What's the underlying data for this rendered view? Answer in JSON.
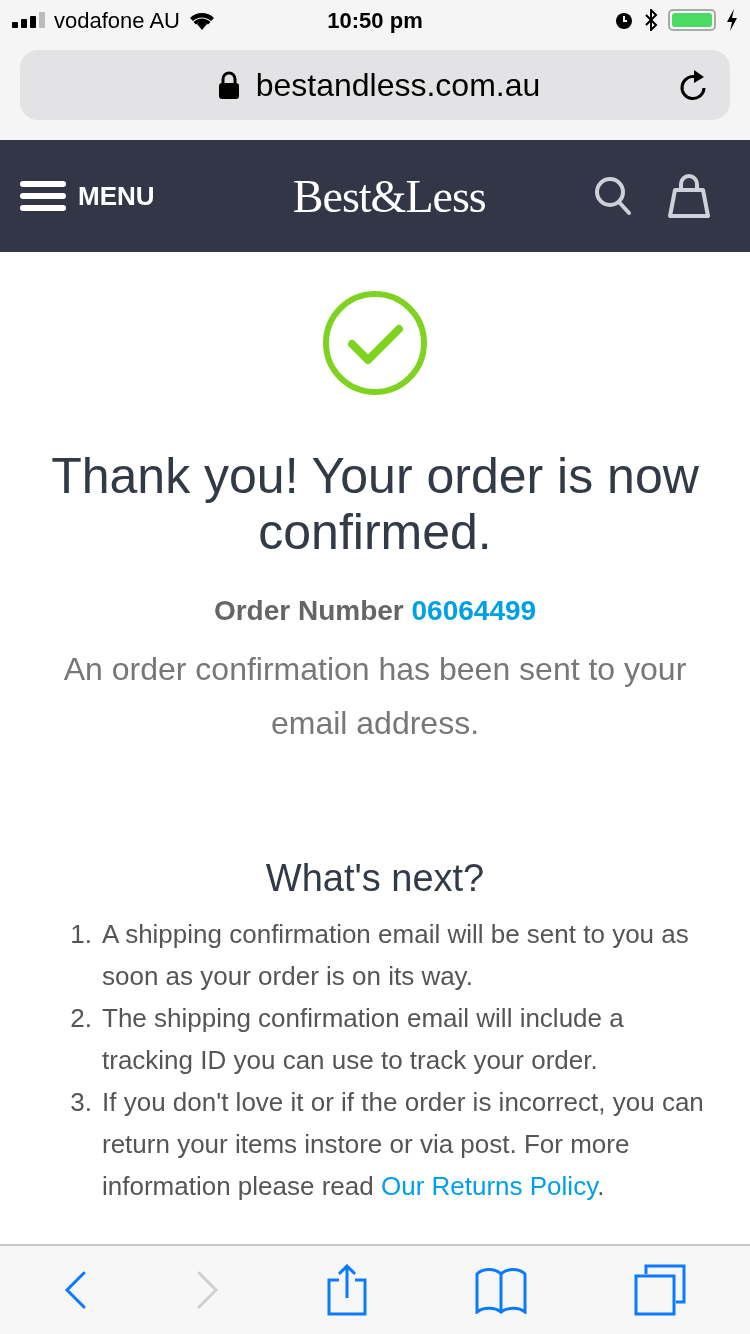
{
  "status_bar": {
    "carrier": "vodafone AU",
    "time": "10:50 pm"
  },
  "address_bar": {
    "url": "bestandless.com.au"
  },
  "header": {
    "menu_label": "MENU",
    "logo": "Best&Less"
  },
  "confirmation": {
    "title": "Thank you! Your order is now confirmed.",
    "order_label": "Order Number",
    "order_number": "06064499",
    "message": "An order confirmation has been sent to your email address."
  },
  "next_steps": {
    "title": "What's next?",
    "items": [
      {
        "number": "1.",
        "text": "A shipping confirmation email will be sent to you as soon as your order is on its way."
      },
      {
        "number": "2.",
        "text": "The shipping confirmation email will include a tracking ID you can use to track your order."
      },
      {
        "number": "3.",
        "text": "If you don't love it or if the order is incorrect, you can return your items instore or via post. For more information please read",
        "link": "Our Returns Policy",
        "after": "."
      }
    ]
  },
  "toolbar": {
    "back_disabled": false,
    "forward_disabled": true
  }
}
